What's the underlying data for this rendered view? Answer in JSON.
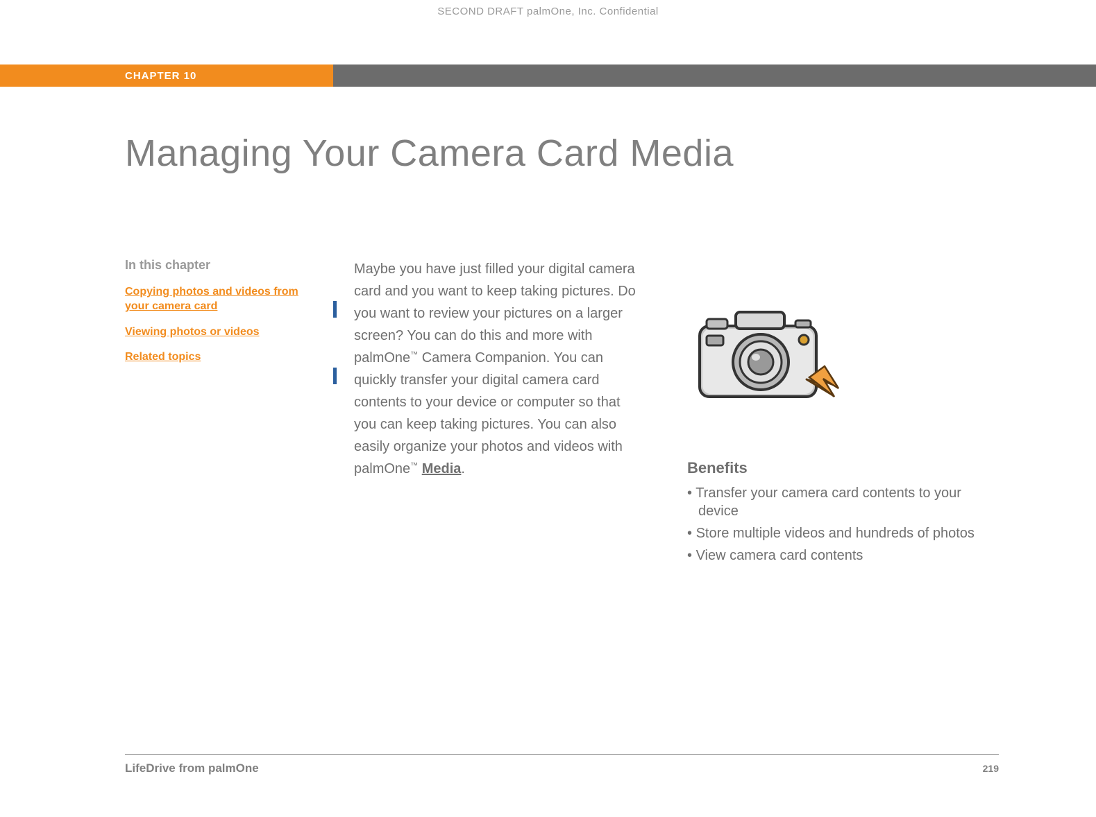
{
  "header": {
    "confidential": "SECOND DRAFT palmOne, Inc.  Confidential",
    "chapter_label": "CHAPTER 10"
  },
  "title": "Managing Your Camera Card Media",
  "sidebar": {
    "heading": "In this chapter",
    "links": [
      "Copying photos and videos from your camera card",
      "Viewing photos or videos",
      "Related topics"
    ]
  },
  "main": {
    "paragraph_part1": "Maybe you have just filled your digital camera card and you want to keep taking pictures. Do you want to review your pictures on a larger screen? You can do this and more with palmOne",
    "tm1": "™",
    "paragraph_part2": " Camera Companion. You can quickly transfer your digital camera card contents to your device or computer so that you can keep taking pictures. You can also easily organize your photos and videos with palmOne",
    "tm2": "™",
    "space": " ",
    "media_link": "Media",
    "period": "."
  },
  "benefits": {
    "heading": "Benefits",
    "items": [
      "Transfer your camera card contents to your device",
      "Store multiple videos and hundreds of photos",
      "View camera card contents"
    ]
  },
  "footer": {
    "left": "LifeDrive from palmOne",
    "page_number": "219"
  }
}
